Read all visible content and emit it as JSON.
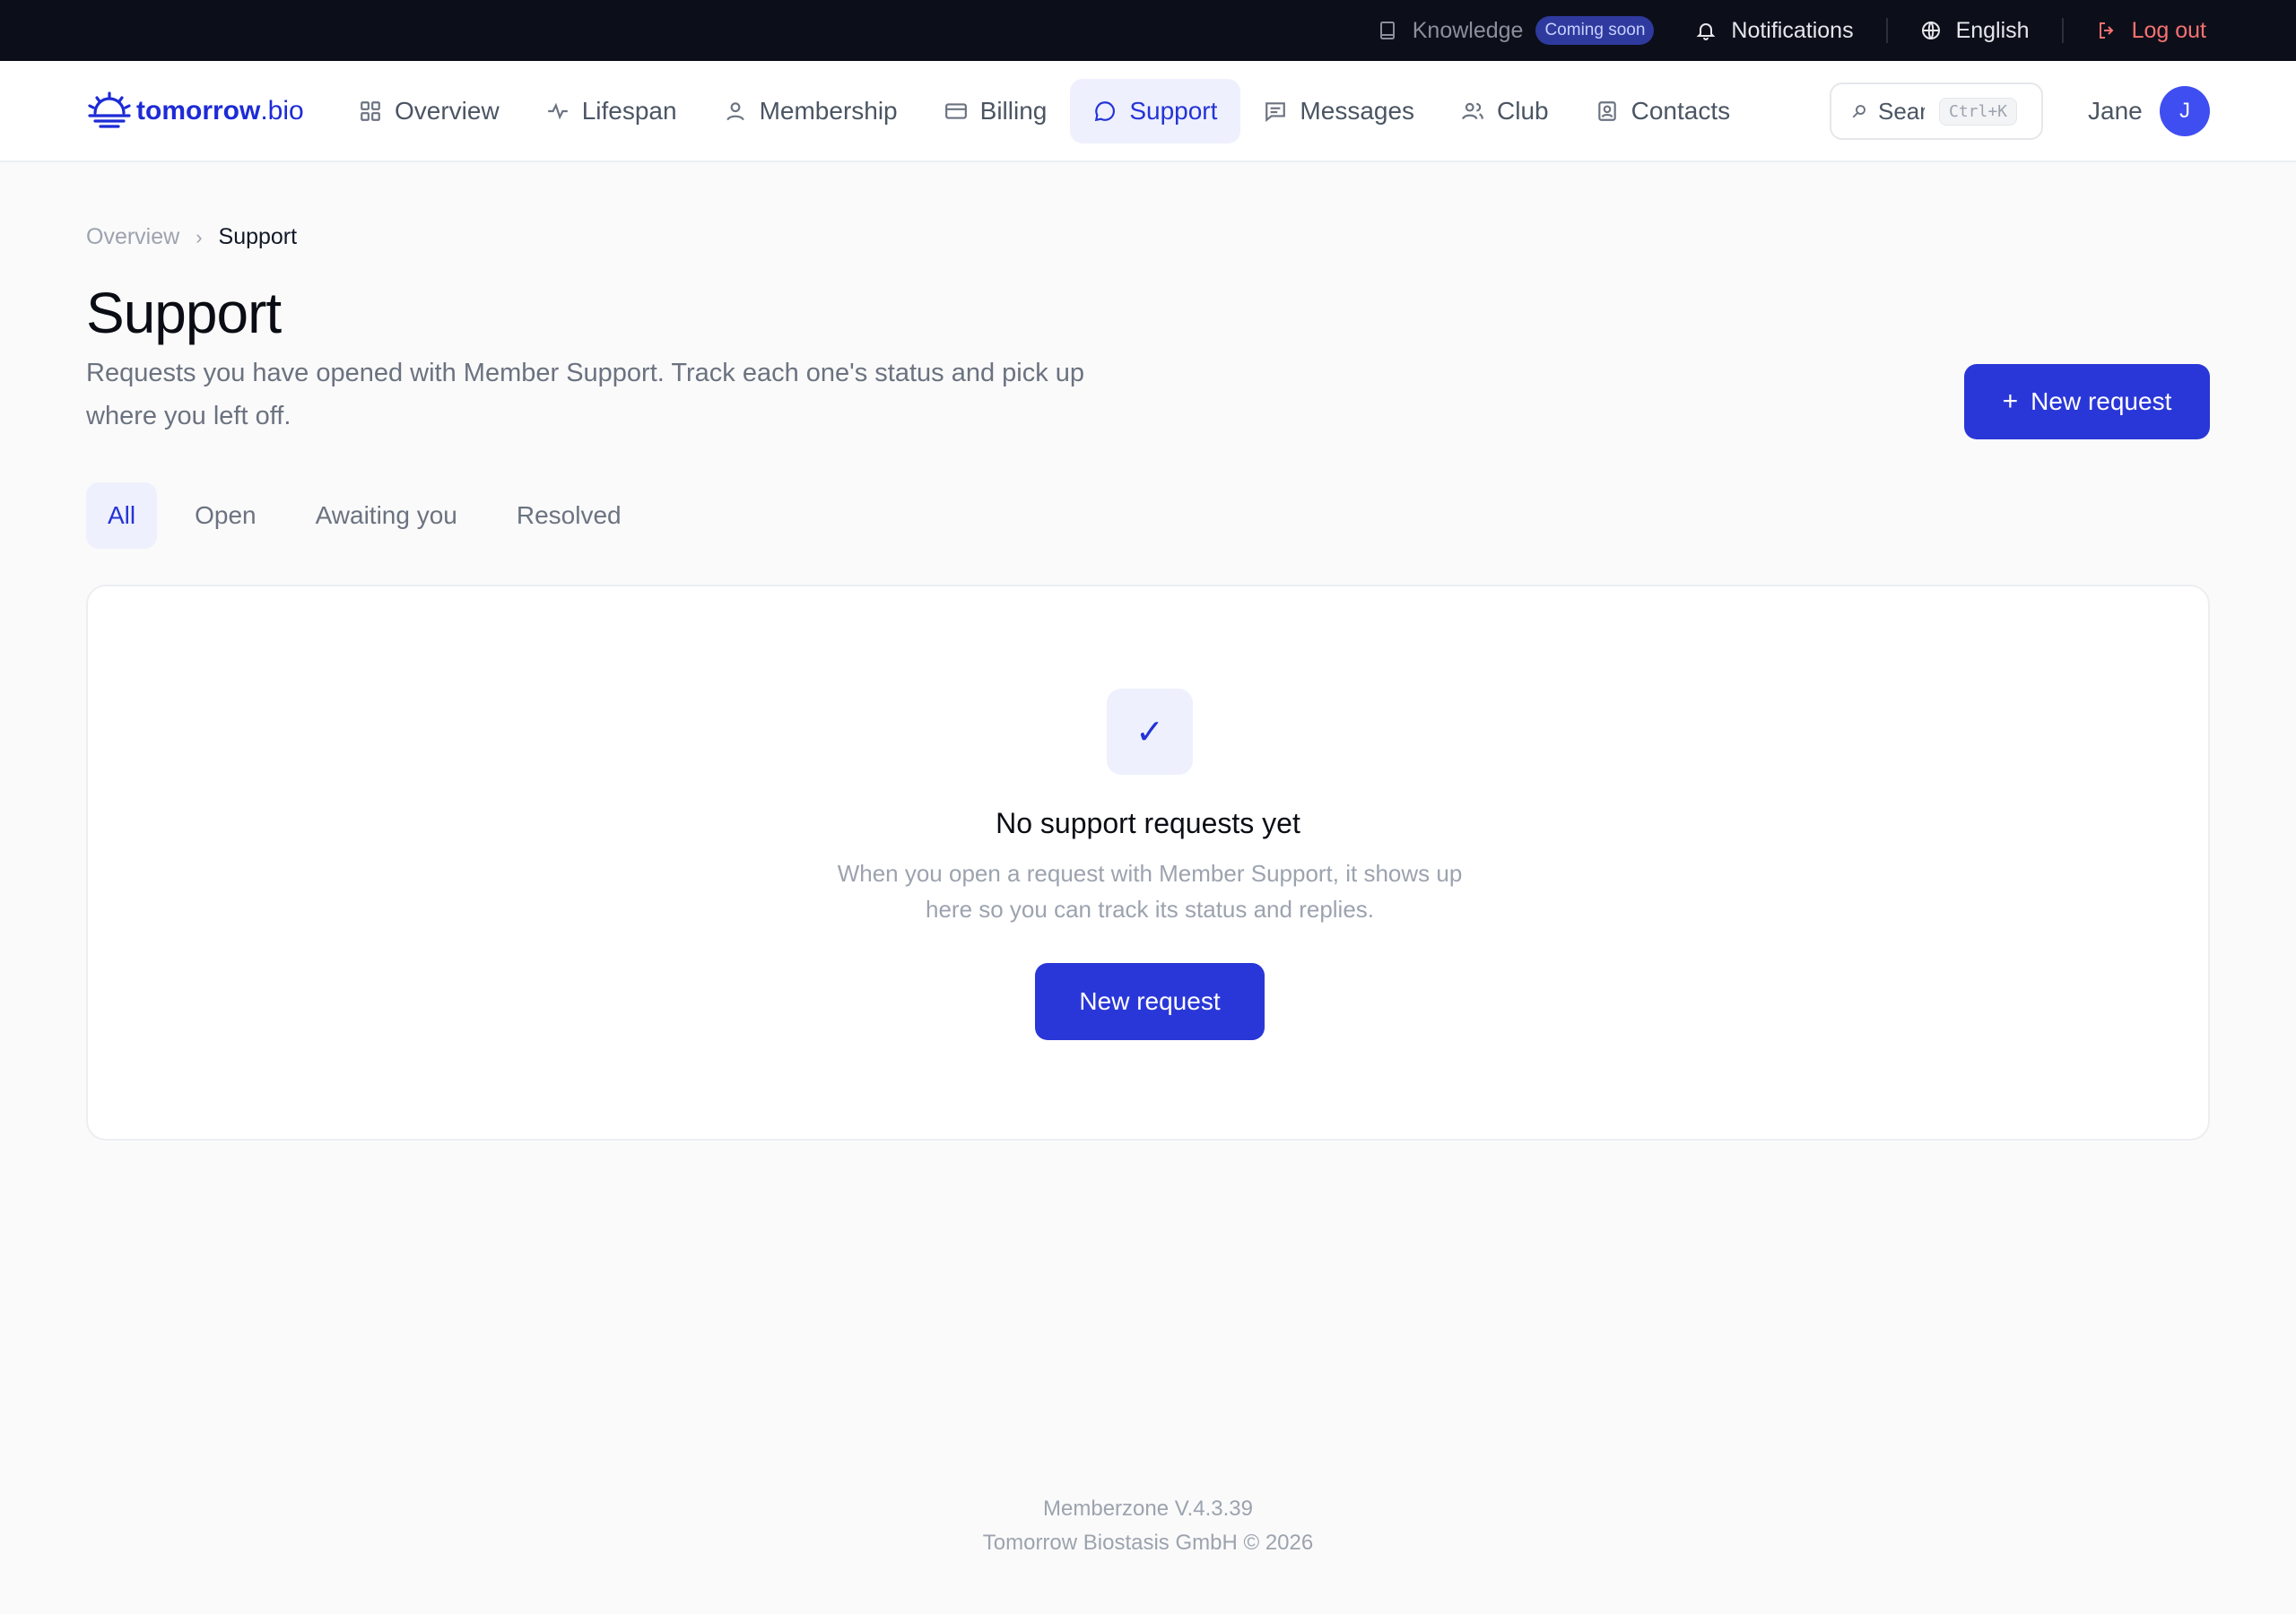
{
  "topbar": {
    "knowledge_label": "Knowledge",
    "knowledge_badge": "Coming soon",
    "notifications_label": "Notifications",
    "language_label": "English",
    "logout_label": "Log out"
  },
  "brand": {
    "name_bold": "tomorrow",
    "name_light": ".bio"
  },
  "nav": {
    "items": [
      {
        "label": "Overview",
        "icon": "grid-icon"
      },
      {
        "label": "Lifespan",
        "icon": "pulse-icon"
      },
      {
        "label": "Membership",
        "icon": "user-icon"
      },
      {
        "label": "Billing",
        "icon": "card-icon"
      },
      {
        "label": "Support",
        "icon": "chat-icon",
        "active": true
      },
      {
        "label": "Messages",
        "icon": "message-icon"
      },
      {
        "label": "Club",
        "icon": "users-icon"
      },
      {
        "label": "Contacts",
        "icon": "contact-icon"
      }
    ],
    "search_placeholder": "Search",
    "search_shortcut": "Ctrl+K",
    "user_name": "Jane",
    "user_initial": "J"
  },
  "breadcrumb": {
    "parent": "Overview",
    "separator": "›",
    "current": "Support"
  },
  "page": {
    "title": "Support",
    "description": "Requests you have opened with Member Support. Track each one's status and pick up where you left off.",
    "new_request_plus": "+",
    "new_request_label": "New request"
  },
  "tabs": [
    "All",
    "Open",
    "Awaiting you",
    "Resolved"
  ],
  "empty_state": {
    "icon_glyph": "✓",
    "title": "No support requests yet",
    "description": "When you open a request with Member Support, it shows up here so you can track its status and replies.",
    "button_label": "New request"
  },
  "footer": {
    "version": "Memberzone V.4.3.39",
    "copyright": "Tomorrow Biostasis GmbH © 2026"
  },
  "colors": {
    "accent": "#2a37d8",
    "accent_soft": "#eef0fd",
    "topbar_bg": "#0c0f1a",
    "logout": "#f87171"
  }
}
